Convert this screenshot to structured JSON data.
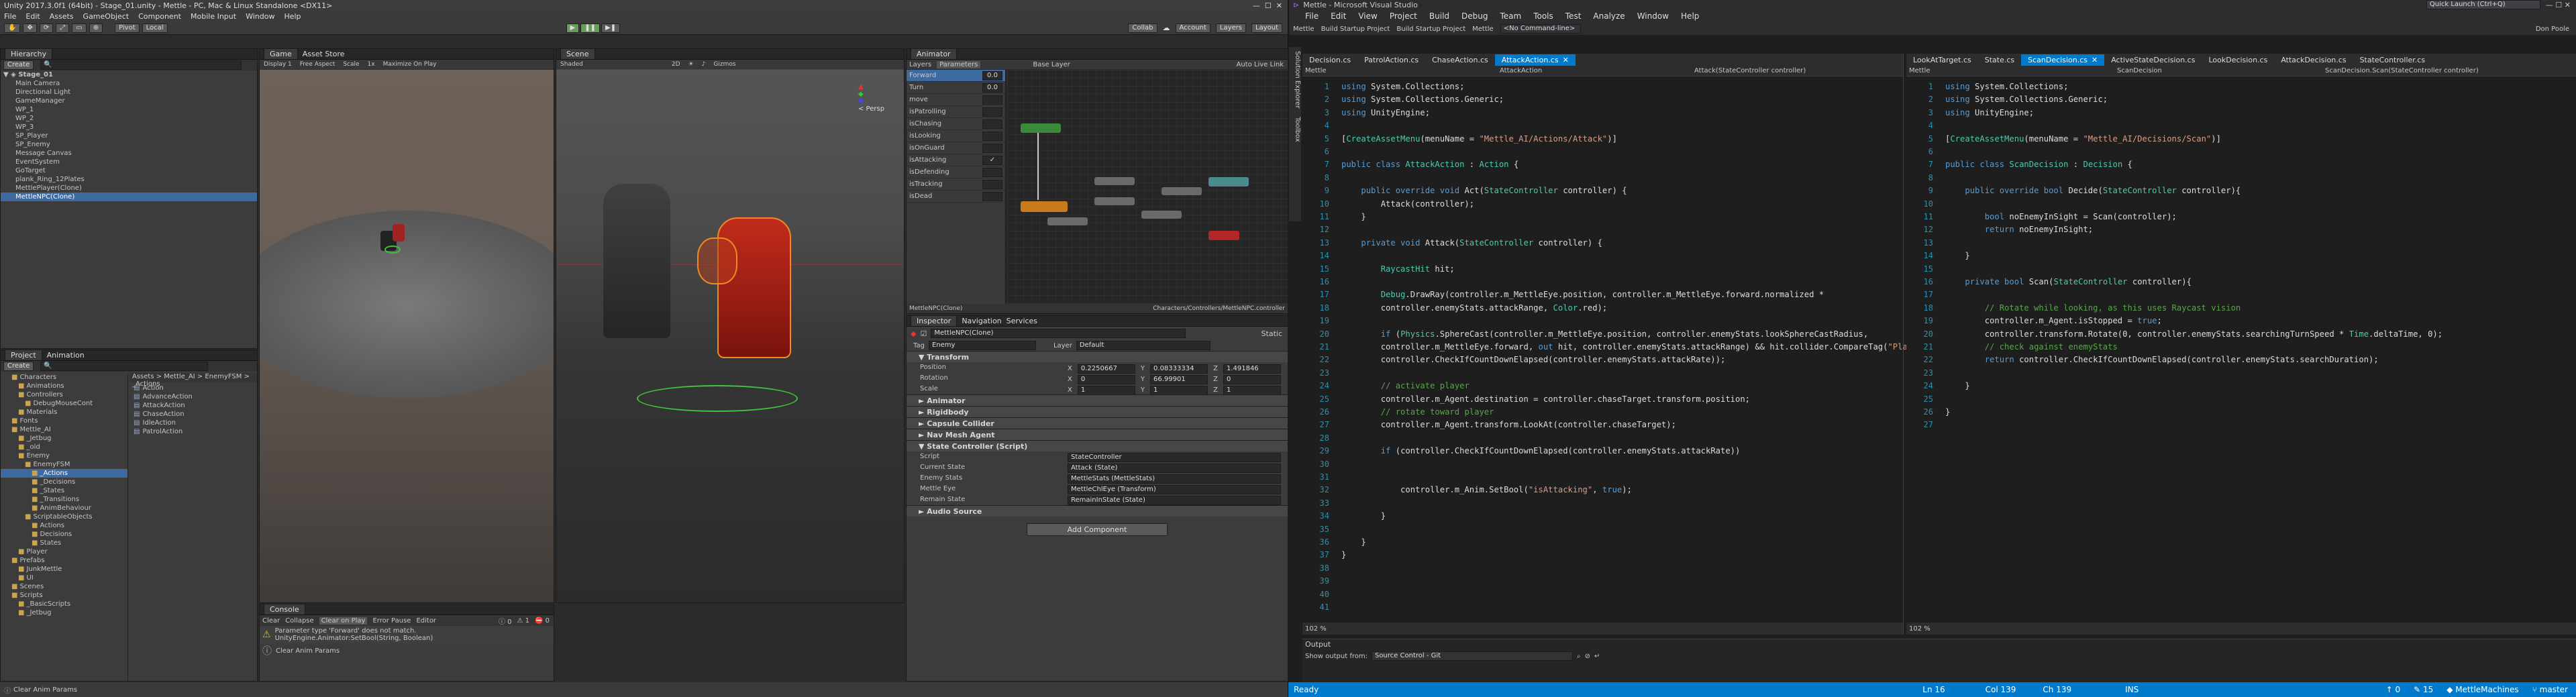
{
  "unity": {
    "title": "Unity 2017.3.0f1 (64bit) - Stage_01.unity - Mettle - PC, Mac & Linux Standalone <DX11>",
    "menu": [
      "File",
      "Edit",
      "Assets",
      "GameObject",
      "Component",
      "Mobile Input",
      "Window",
      "Help"
    ],
    "toolbar": {
      "pivot": "Pivot",
      "local": "Local",
      "collab": "Collab",
      "account": "Account",
      "layers": "Layers",
      "layout": "Layout"
    },
    "hierarchy": {
      "tab": "Hierarchy",
      "create": "Create",
      "scene": "Stage_01",
      "items": [
        "Main Camera",
        "Directional Light",
        "GameManager",
        "WP_1",
        "WP_2",
        "WP_3",
        "SP_Player",
        "SP_Enemy",
        "Message Canvas",
        "EventSystem",
        "GoTarget",
        "plank_Ring_12Plates",
        "MettlePlayer(Clone)",
        "MettleNPC(Clone)"
      ]
    },
    "game": {
      "tab": "Game",
      "tab2": "Asset Store",
      "display": "Display 1",
      "aspect": "Free Aspect",
      "scale": "Scale",
      "scale_val": "1x",
      "maximize": "Maximize On Play"
    },
    "scene": {
      "tab": "Scene",
      "shaded": "Shaded",
      "mode2d": "2D",
      "gizmos": "Gizmos",
      "persp": "< Persp"
    },
    "animator": {
      "tab": "Animator",
      "layers": "Layers",
      "parameters": "Parameters",
      "base_layer": "Base Layer",
      "auto_live": "Auto Live Link",
      "footer_left": "MettleNPC(Clone)",
      "footer_right": "Characters/Controllers/MettleNPC.controller",
      "params": [
        {
          "name": "Forward",
          "val": "0.0"
        },
        {
          "name": "Turn",
          "val": "0.0"
        },
        {
          "name": "move",
          "val": ""
        },
        {
          "name": "isPatrolling",
          "val": ""
        },
        {
          "name": "isChasing",
          "val": ""
        },
        {
          "name": "isLooking",
          "val": ""
        },
        {
          "name": "isOnGuard",
          "val": ""
        },
        {
          "name": "isAttacking",
          "val": "✓"
        },
        {
          "name": "isDefending",
          "val": ""
        },
        {
          "name": "isTracking",
          "val": ""
        },
        {
          "name": "isDead",
          "val": ""
        }
      ]
    },
    "inspector": {
      "tab": "Inspector",
      "tab2": "Navigation",
      "tab3": "Services",
      "name": "MettleNPC(Clone)",
      "static": "Static",
      "tag_label": "Tag",
      "tag": "Enemy",
      "layer_label": "Layer",
      "layer": "Default",
      "transform": "Transform",
      "pos_label": "Position",
      "pos": [
        "0.2250667",
        "0.08333334",
        "1.491846"
      ],
      "rot_label": "Rotation",
      "rot": [
        "0",
        "66.99901",
        "0"
      ],
      "scale_label": "Scale",
      "scale": [
        "1",
        "1",
        "1"
      ],
      "components": [
        "Animator",
        "Rigidbody",
        "Capsule Collider",
        "Nav Mesh Agent",
        "State Controller (Script)"
      ],
      "sc_props": [
        {
          "k": "Script",
          "v": "StateController"
        },
        {
          "k": "Current State",
          "v": "Attack (State)"
        },
        {
          "k": "Enemy Stats",
          "v": "MettleStats (MettleStats)"
        },
        {
          "k": "Mettle Eye",
          "v": "MettleChlEye (Transform)"
        },
        {
          "k": "Remain State",
          "v": "RemainInState (State)"
        }
      ],
      "audio": "Audio Source",
      "add_component": "Add Component"
    },
    "project": {
      "tab": "Project",
      "tab2": "Animation",
      "create": "Create",
      "path": "Assets > Mettle_AI > EnemyFSM > _Actions",
      "tree": [
        "Characters",
        "Animations",
        "Controllers",
        "DebugMouseCont",
        "Materials",
        "Fonts",
        "Mettle_AI",
        "_Jetbug",
        "_old",
        "Enemy",
        "EnemyFSM",
        "_Actions",
        "_Decisions",
        "_States",
        "_Transitions",
        "AnimBehaviour",
        "ScriptableObjects",
        "Actions",
        "Decisions",
        "States",
        "Player",
        "Prefabs",
        "JunkMettle",
        "UI",
        "Scenes",
        "Scripts",
        "_BasicScripts",
        "_Jetbug"
      ],
      "files": [
        "Action",
        "AdvanceAction",
        "AttackAction",
        "ChaseAction",
        "IdleAction",
        "PatrolAction"
      ]
    },
    "console": {
      "tab": "Console",
      "clear": "Clear",
      "collapse": "Collapse",
      "clear_on_play": "Clear on Play",
      "error_pause": "Error Pause",
      "editor": "Editor",
      "count_warn": "1",
      "count_info": "0",
      "count_err": "0",
      "msg1": "Parameter type 'Forward' does not match.",
      "msg1b": "UnityEngine.Animator:SetBool(String, Boolean)",
      "msg2": "Clear Anim Params"
    },
    "status": "Clear Anim Params"
  },
  "vs": {
    "title": "Mettle - Microsoft Visual Studio",
    "quick_launch": "Quick Launch (Ctrl+Q)",
    "user": "Don Poole",
    "menu": [
      "File",
      "Edit",
      "View",
      "Project",
      "Build",
      "Debug",
      "Team",
      "Tools",
      "Test",
      "Analyze",
      "Window",
      "Help"
    ],
    "toolbar": {
      "project": "Mettle",
      "startup": "Build Startup Project",
      "build_startup": "Build Startup Project",
      "mettle2": "Mettle",
      "cmdline": "<No Command-line>"
    },
    "left": {
      "tabs": [
        "Decision.cs",
        "PatrolAction.cs",
        "ChaseAction.cs",
        "AttackAction.cs"
      ],
      "active": 3,
      "nav1": "Mettle",
      "nav2": "AttackAction",
      "nav3": "Attack(StateController controller)",
      "zoom": "102 %"
    },
    "right": {
      "tabs": [
        "LookAtTarget.cs",
        "State.cs",
        "ScanDecision.cs",
        "ActiveStateDecision.cs",
        "LookDecision.cs",
        "AttackDecision.cs",
        "StateController.cs"
      ],
      "active": 2,
      "nav1": "Mettle",
      "nav2": "ScanDecision",
      "nav3": "ScanDecision.Scan(StateController controller)",
      "zoom": "102 %"
    },
    "side": [
      "Solution Explorer",
      "Toolbox"
    ],
    "output": {
      "title": "Output",
      "show_from": "Show output from:",
      "source": "Source Control - Git"
    },
    "status": {
      "ready": "Ready",
      "ln": "Ln 16",
      "col": "Col 139",
      "ch": "Ch 139",
      "ins": "INS",
      "up": "0",
      "edits": "15",
      "repo": "MettleMachines",
      "branch": "master"
    }
  }
}
